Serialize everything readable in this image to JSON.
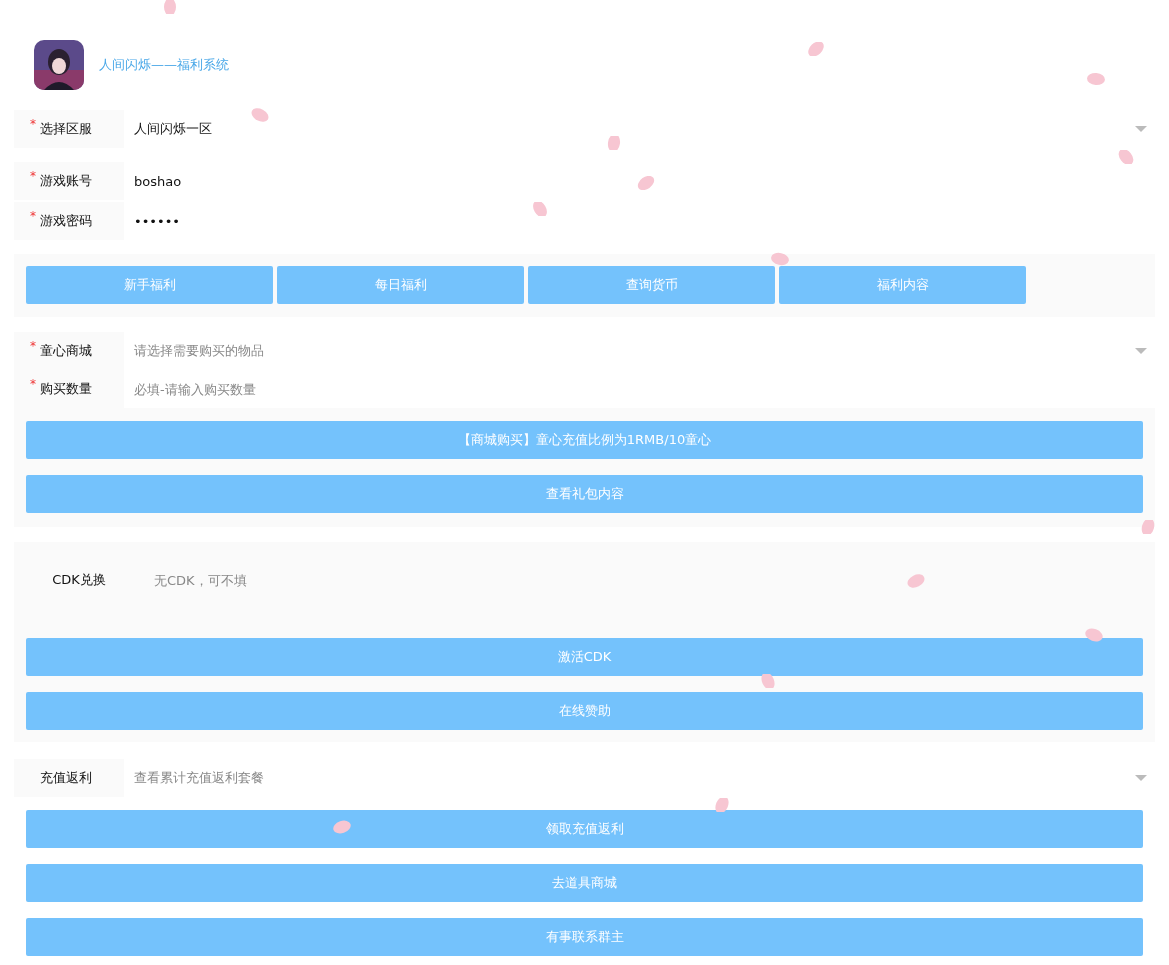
{
  "header": {
    "title": "人间闪烁——福利系统"
  },
  "login": {
    "fields": [
      {
        "kind": "select",
        "label": "选择区服",
        "required_mark": "*",
        "value": "人间闪烁一区"
      },
      {
        "kind": "input",
        "label": "游戏账号",
        "required_mark": "*",
        "value": "boshao"
      },
      {
        "kind": "password",
        "label": "游戏密码",
        "required_mark": "*",
        "value": "••••••"
      }
    ]
  },
  "welfare_buttons": [
    "新手福利",
    "每日福利",
    "查询货币",
    "福利内容"
  ],
  "shop": {
    "fields": [
      {
        "kind": "select",
        "label": "童心商城",
        "required_mark": "*",
        "placeholder": "请选择需要购买的物品"
      },
      {
        "kind": "input",
        "label": "购买数量",
        "required_mark": "*",
        "placeholder": "必填-请输入购买数量"
      }
    ],
    "buttons": [
      "【商城购买】童心充值比例为1RMB/10童心",
      "查看礼包内容"
    ]
  },
  "cdk": {
    "field": {
      "kind": "input",
      "label": "CDK兑换",
      "placeholder": "无CDK，可不填"
    },
    "buttons": [
      "激活CDK",
      "在线赞助"
    ]
  },
  "rebate": {
    "field": {
      "kind": "select",
      "label": "充值返利",
      "placeholder": "查看累计充值返利套餐"
    },
    "buttons": [
      "领取充值返利",
      "去道具商城",
      "有事联系群主"
    ]
  }
}
